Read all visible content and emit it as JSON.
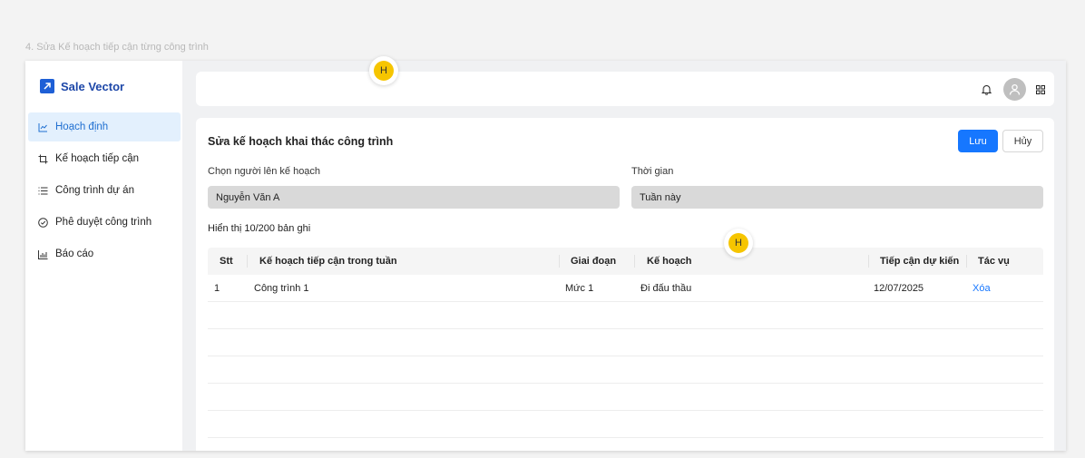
{
  "frame_label": "4. Sửa Kế hoạch tiếp cận từng công trình",
  "app": {
    "name": "Sale Vector",
    "logo_icon": "arrow-up-right-icon",
    "brand_color": "#1e5fd6"
  },
  "sidebar": {
    "items": [
      {
        "label": "Hoạch định",
        "icon": "line-chart-icon",
        "active": true
      },
      {
        "label": "Kế hoạch tiếp cận",
        "icon": "crop-frame-icon",
        "active": false
      },
      {
        "label": "Công trình dự án",
        "icon": "list-icon",
        "active": false
      },
      {
        "label": "Phê duyệt công trình",
        "icon": "check-circle-icon",
        "active": false
      },
      {
        "label": "Báo cáo",
        "icon": "bar-chart-icon",
        "active": false
      }
    ]
  },
  "topbar": {
    "icons": [
      "bell-icon",
      "user-avatar-icon",
      "apps-grid-icon"
    ]
  },
  "panel": {
    "title": "Sửa kế hoạch khai thác công trình",
    "save_label": "Lưu",
    "cancel_label": "Hủy",
    "person_label": "Chọn người lên kế hoạch",
    "person_value": "Nguyễn Văn A",
    "time_label": "Thời gian",
    "time_value": "Tuần này",
    "record_count": "Hiển thị 10/200 bản ghi"
  },
  "table": {
    "headers": [
      "Stt",
      "Kế hoạch tiếp cận trong tuần",
      "Giai đoạn",
      "Kế hoạch",
      "Tiếp cận dự kiến",
      "Tác vụ"
    ],
    "rows": [
      {
        "stt": "1",
        "name": "Công trình 1",
        "stage": "Mức 1",
        "plan": "Đi đấu thầu",
        "date": "12/07/2025",
        "action": "Xóa"
      }
    ]
  },
  "cursors": [
    "H",
    "H"
  ],
  "colors": {
    "accent": "#1677ff",
    "active_bg": "#e3f0fd",
    "cursor": "#f6c500"
  }
}
